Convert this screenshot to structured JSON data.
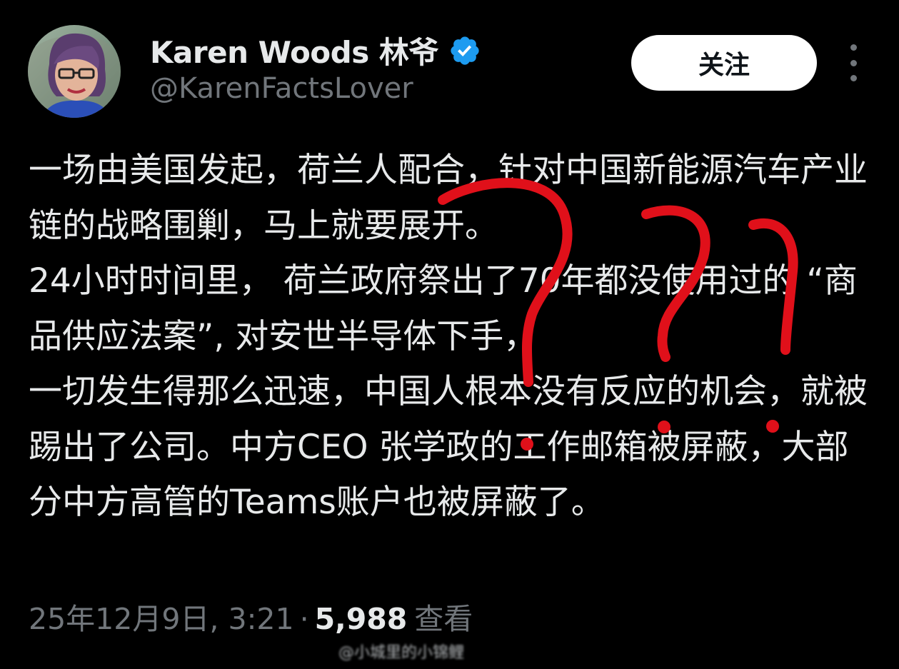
{
  "author": {
    "display_name": "Karen Woods 林爷",
    "handle": "@KarenFactsLover",
    "verified_icon": "verified-badge-icon",
    "verified_color": "#1d9bf0"
  },
  "actions": {
    "follow_label": "关注",
    "more_icon": "more-vertical-icon"
  },
  "tweet": {
    "text": "一场由美国发起，荷兰人配合，针对中国新能源汽车产业链的战略围剿，马上就要展开。\n24小时时间里， 荷兰政府祭出了70年都没使用过的 “商品供应法案”, 对安世半导体下手，\n一切发生得那么迅速，中国人根本没有反应的机会，就被踢出了公司。中方CEO 张学政的工作邮箱被屏蔽，大部分中方高管的Teams账户也被屏蔽了。"
  },
  "meta": {
    "timestamp": "25年12月9日, 3:21",
    "separator": "·",
    "views_count": "5,988",
    "views_label": "查看"
  },
  "annotation": {
    "description_icon": "hand-drawn-question-marks",
    "color": "#e0101a"
  },
  "watermark": {
    "text": "@小城里的小锦鲤"
  }
}
